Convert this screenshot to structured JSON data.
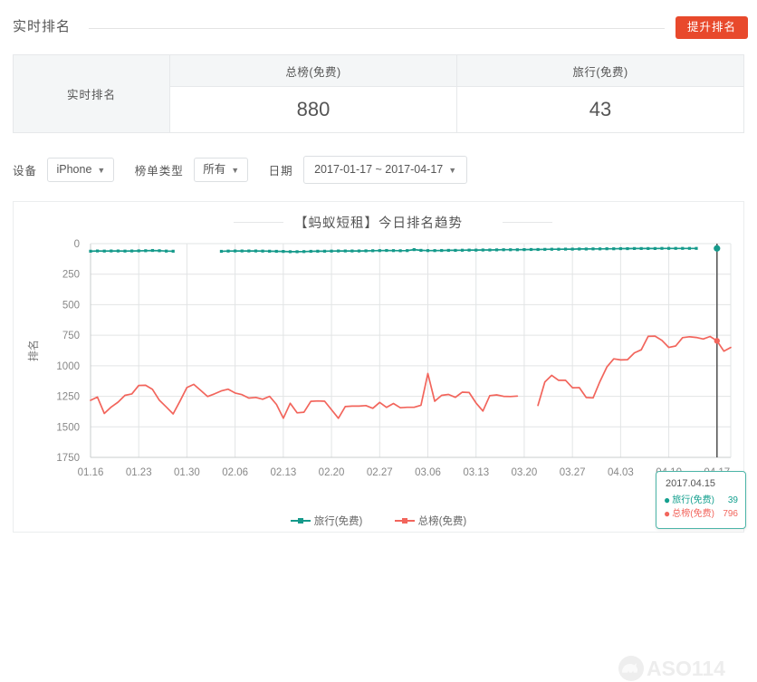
{
  "header": {
    "title": "实时排名",
    "promote_button": "提升排名"
  },
  "rank_table": {
    "row_label": "实时排名",
    "columns": [
      {
        "header": "总榜(免费)",
        "value": "880"
      },
      {
        "header": "旅行(免费)",
        "value": "43"
      }
    ]
  },
  "filters": {
    "device": {
      "label": "设备",
      "value": "iPhone",
      "caret": "▼"
    },
    "list_type": {
      "label": "榜单类型",
      "value": "所有",
      "caret": "▼"
    },
    "date": {
      "label": "日期",
      "value": "2017-01-17 ~ 2017-04-17",
      "caret": "▼"
    }
  },
  "chart_card": {
    "title": "【蚂蚁短租】今日排名趋势",
    "watermark": "ASO114"
  },
  "tooltip": {
    "date": "2017.04.15",
    "rows": [
      {
        "dot": "●",
        "name": "旅行(免费)",
        "value": "39",
        "color": "#15a08f"
      },
      {
        "dot": "●",
        "name": "总榜(免费)",
        "value": "796",
        "color": "#f2655c"
      }
    ]
  },
  "legend": {
    "items": [
      {
        "label": "旅行(免费)",
        "color": "#159a8b"
      },
      {
        "label": "总榜(免费)",
        "color": "#f2655c"
      }
    ]
  },
  "chart_data": {
    "type": "line",
    "title": "【蚂蚁短租】今日排名趋势",
    "xlabel": "",
    "ylabel": "排名",
    "ylim": [
      0,
      1750
    ],
    "y_inverted": true,
    "grid": true,
    "legend_position": "bottom",
    "y_ticks": [
      0,
      250,
      500,
      750,
      1000,
      1250,
      1500,
      1750
    ],
    "x_ticks": [
      "01.16",
      "01.23",
      "01.30",
      "02.06",
      "02.13",
      "02.20",
      "02.27",
      "03.06",
      "03.13",
      "03.20",
      "03.27",
      "04.03",
      "04.10",
      "04.17"
    ],
    "x_start": "2017-01-16",
    "x_end": "2017-04-17",
    "colors": {
      "travel": "#159a8b",
      "overall": "#f2655c",
      "grid": "#e2e4e5",
      "axis": "#c9cccd",
      "crosshair": "#595959"
    },
    "highlight": {
      "date": "2017.04.15",
      "travel": 39,
      "overall": 796
    },
    "series": [
      {
        "name": "旅行(免费)",
        "color": "#159a8b",
        "values": [
          62,
          60,
          61,
          60,
          60,
          61,
          60,
          59,
          58,
          56,
          58,
          61,
          62,
          null,
          null,
          null,
          null,
          null,
          null,
          63,
          61,
          60,
          60,
          60,
          60,
          61,
          62,
          63,
          64,
          66,
          66,
          65,
          63,
          62,
          62,
          61,
          60,
          60,
          60,
          60,
          59,
          58,
          57,
          56,
          57,
          58,
          57,
          49,
          55,
          57,
          57,
          56,
          55,
          55,
          54,
          53,
          53,
          52,
          52,
          51,
          50,
          50,
          50,
          49,
          48,
          48,
          47,
          46,
          46,
          45,
          45,
          44,
          44,
          43,
          43,
          42,
          42,
          41,
          41,
          40,
          40,
          40,
          40,
          39,
          39,
          39,
          39,
          39,
          39,
          null,
          null
        ]
      },
      {
        "name": "总榜(免费)",
        "color": "#f2655c",
        "values": [
          1283,
          1256,
          1390,
          1338,
          1298,
          1242,
          1230,
          1161,
          1160,
          1193,
          1282,
          1337,
          1394,
          1289,
          1178,
          1152,
          1201,
          1252,
          1230,
          1206,
          1192,
          1223,
          1236,
          1264,
          1259,
          1274,
          1250,
          1316,
          1430,
          1307,
          1385,
          1380,
          1291,
          1288,
          1290,
          1360,
          1430,
          1334,
          1330,
          1330,
          1326,
          1348,
          1300,
          1341,
          1309,
          1344,
          1340,
          1340,
          1323,
          1063,
          1290,
          1242,
          1235,
          1258,
          1216,
          1219,
          1304,
          1370,
          1244,
          1238,
          1250,
          1252,
          1248,
          null,
          null,
          1324,
          1132,
          1078,
          1119,
          1118,
          1180,
          1179,
          1260,
          1263,
          1128,
          1010,
          943,
          952,
          950,
          894,
          869,
          759,
          757,
          792,
          850,
          838,
          770,
          762,
          768,
          781,
          760,
          796,
          880,
          850
        ]
      }
    ]
  }
}
